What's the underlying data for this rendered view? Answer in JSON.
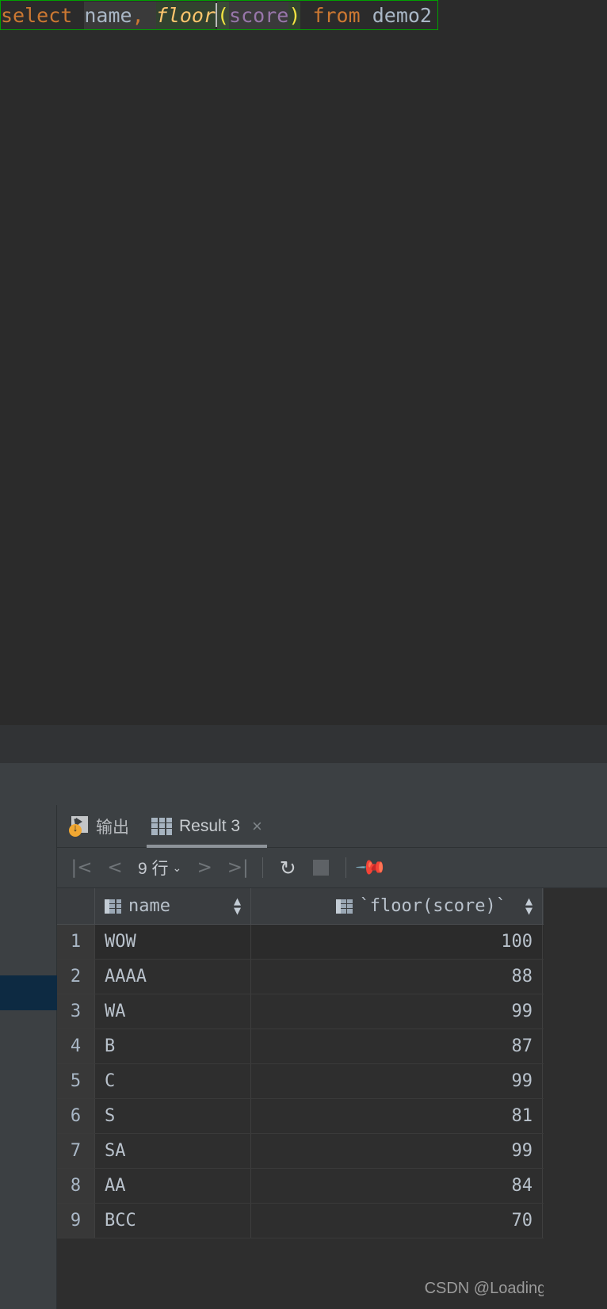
{
  "editor": {
    "sql_tokens": [
      {
        "text": "select",
        "type": "keyword"
      },
      {
        "text": " ",
        "type": "plain"
      },
      {
        "text": "name",
        "type": "identifier"
      },
      {
        "text": ",",
        "type": "punct"
      },
      {
        "text": " ",
        "type": "plain"
      },
      {
        "text": "floor",
        "type": "function"
      },
      {
        "text": "(",
        "type": "paren"
      },
      {
        "text": "score",
        "type": "column"
      },
      {
        "text": ")",
        "type": "paren"
      },
      {
        "text": " ",
        "type": "plain"
      },
      {
        "text": "from",
        "type": "keyword"
      },
      {
        "text": " ",
        "type": "plain"
      },
      {
        "text": "demo2",
        "type": "identifier"
      }
    ],
    "sql_text": "select name, floor(score) from demo2",
    "highlight_border_color": "#00a000"
  },
  "panel": {
    "tabs": [
      {
        "id": "output",
        "label": "输出",
        "icon": "output-icon",
        "active": false,
        "closable": false
      },
      {
        "id": "result3",
        "label": "Result 3",
        "icon": "grid-icon",
        "active": true,
        "closable": true,
        "close_label": "×"
      }
    ],
    "toolbar": {
      "first_page": "|<",
      "prev_page": "<",
      "row_count_label": "9 行",
      "row_count_chevron": "⌄",
      "next_page": ">",
      "last_page": ">|",
      "refresh": "refresh-icon",
      "stop": "stop-icon",
      "pin": "pin-icon"
    }
  },
  "result_table": {
    "columns": [
      {
        "key": "rownum",
        "label": ""
      },
      {
        "key": "name",
        "label": "name",
        "sortable": true,
        "sort_glyph_up": "▲",
        "sort_glyph_down": "▼"
      },
      {
        "key": "floor_score",
        "label": "`floor(score)`",
        "sortable": true,
        "sort_glyph_up": "▲",
        "sort_glyph_down": "▼"
      }
    ],
    "rows": [
      {
        "rownum": "1",
        "name": "WOW",
        "floor_score": "100"
      },
      {
        "rownum": "2",
        "name": "AAAA",
        "floor_score": "88"
      },
      {
        "rownum": "3",
        "name": "WA",
        "floor_score": "99"
      },
      {
        "rownum": "4",
        "name": "B",
        "floor_score": "87"
      },
      {
        "rownum": "5",
        "name": "C",
        "floor_score": "99"
      },
      {
        "rownum": "6",
        "name": "S",
        "floor_score": "81"
      },
      {
        "rownum": "7",
        "name": "SA",
        "floor_score": "99"
      },
      {
        "rownum": "8",
        "name": "AA",
        "floor_score": "84"
      },
      {
        "rownum": "9",
        "name": "BCC",
        "floor_score": "70"
      }
    ]
  },
  "watermark": {
    "text": "CSDN @Loading_create"
  },
  "colors": {
    "editor_bg": "#2b2b2b",
    "panel_bg": "#3c4043",
    "table_bg": "#2e2e2e",
    "selection_blue": "#0d2a42",
    "keyword": "#cc7832",
    "function": "#ffc66d",
    "column": "#9876aa",
    "paren": "#f0e442",
    "text": "#a9b7c6"
  }
}
